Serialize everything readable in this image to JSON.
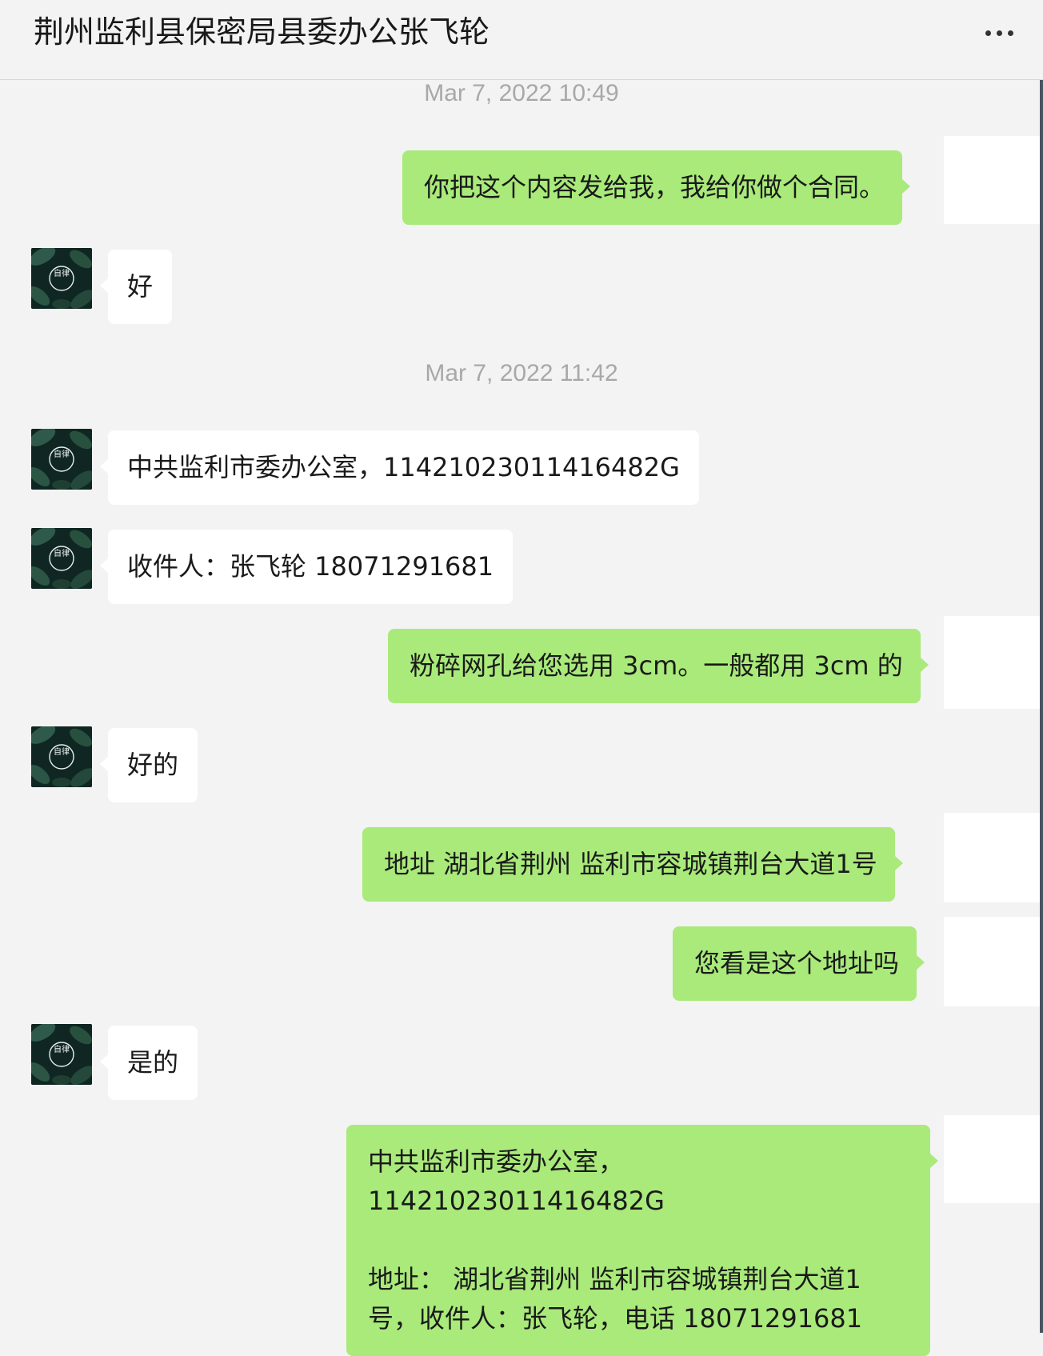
{
  "header": {
    "title": "荆州监利县保密局县委办公张飞轮",
    "more_icon": "more-dots-icon"
  },
  "colors": {
    "background": "#f3f3f3",
    "outgoing_bubble": "#a9ea7a",
    "incoming_bubble": "#ffffff",
    "timestamp_text": "#a8a8a8"
  },
  "avatar": {
    "icon": "contact-avatar-leaves",
    "text": "自律"
  },
  "chat": {
    "timestamps": [
      "Mar 7, 2022 10:49",
      "Mar 7, 2022 11:42"
    ],
    "messages": [
      {
        "direction": "out",
        "text": "你把这个内容发给我，我给你做个合同。"
      },
      {
        "direction": "in",
        "text": "好"
      },
      {
        "direction": "in",
        "text": "中共监利市委办公室，11421023011416482G"
      },
      {
        "direction": "in",
        "text": "收件人：张飞轮 18071291681"
      },
      {
        "direction": "out",
        "text": "粉碎网孔给您选用 3cm。一般都用 3cm 的"
      },
      {
        "direction": "in",
        "text": "好的"
      },
      {
        "direction": "out",
        "text": "地址 湖北省荆州 监利市容城镇荆台大道1号"
      },
      {
        "direction": "out",
        "text": "您看是这个地址吗"
      },
      {
        "direction": "in",
        "text": "是的"
      },
      {
        "direction": "out",
        "lines": [
          "中共监利市委办公室，11421023011416482G",
          "地址： 湖北省荆州 监利市容城镇荆台大道1",
          "号，收件人：张飞轮，电话 18071291681"
        ]
      }
    ]
  }
}
